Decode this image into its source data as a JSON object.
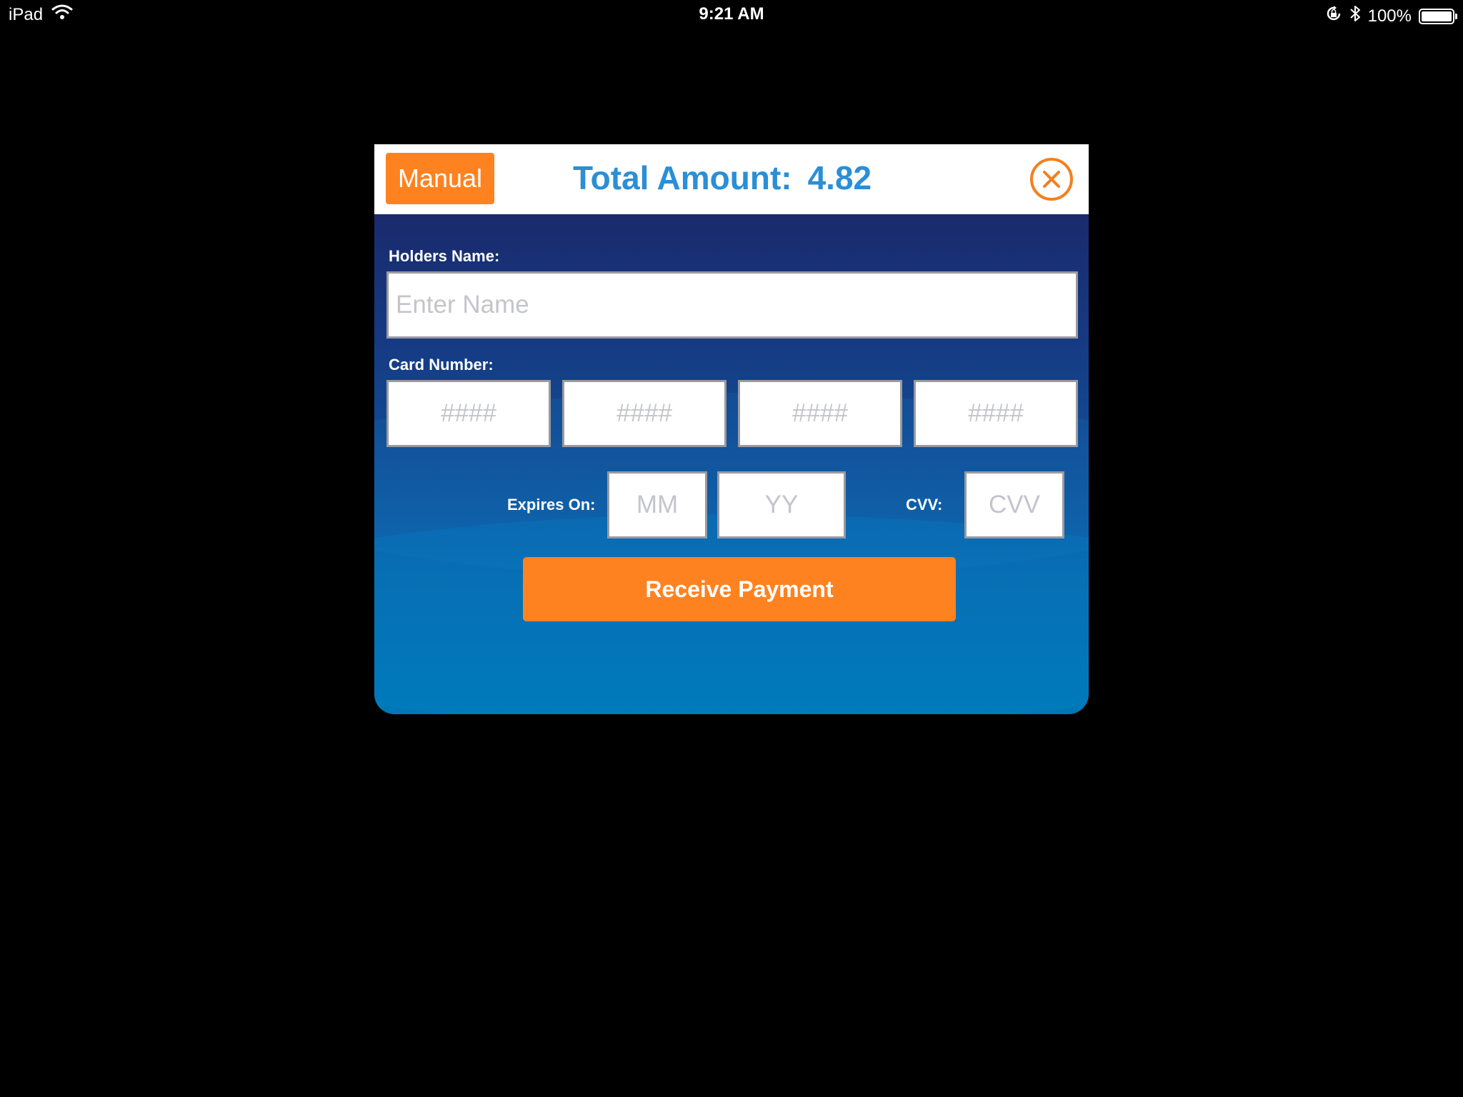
{
  "status_bar": {
    "device": "iPad",
    "time": "9:21 AM",
    "battery_percent": "100%",
    "icons": [
      "wifi-icon",
      "orientation-lock-icon",
      "bluetooth-icon",
      "battery-icon"
    ]
  },
  "header": {
    "manual_label": "Manual",
    "total_label": "Total Amount:",
    "total_value": "4.82",
    "close_icon": "close-icon"
  },
  "form": {
    "holder_label": "Holders Name:",
    "holder_placeholder": "Enter Name",
    "card_label": "Card Number:",
    "card_placeholders": [
      "####",
      "####",
      "####",
      "####"
    ],
    "expires_label": "Expires On:",
    "month_placeholder": "MM",
    "year_placeholder": "YY",
    "cvv_label": "CVV:",
    "cvv_placeholder": "CVV",
    "submit_label": "Receive Payment"
  },
  "colors": {
    "accent": "#ff8220",
    "total_text": "#2a8fd6",
    "background": "#000000"
  }
}
